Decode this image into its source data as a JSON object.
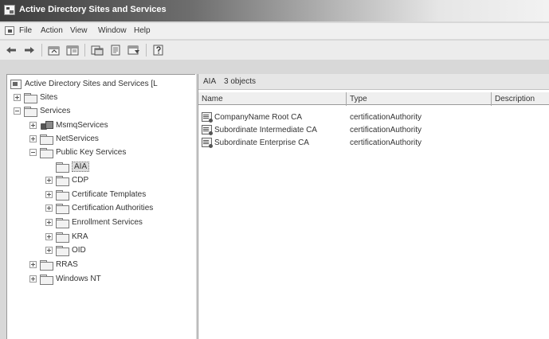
{
  "window": {
    "title": "Active Directory Sites and Services"
  },
  "menu": {
    "items": [
      "File",
      "Action",
      "View",
      "Window",
      "Help"
    ]
  },
  "toolbar": {
    "buttons": [
      "back-arrow-icon",
      "forward-arrow-icon",
      "up-level-icon",
      "show-hide-tree-icon",
      "properties-icon",
      "export-list-icon",
      "refresh-icon",
      "help-icon"
    ]
  },
  "tree": {
    "root": "Active Directory Sites and Services [L",
    "nodes": [
      {
        "label": "Sites",
        "expander": "plus"
      },
      {
        "label": "Services",
        "expander": "minus"
      },
      {
        "label": "MsmqServices",
        "expander": "plus"
      },
      {
        "label": "NetServices",
        "expander": "plus"
      },
      {
        "label": "Public Key Services",
        "expander": "minus"
      },
      {
        "label": "AIA",
        "expander": "none",
        "selected": true
      },
      {
        "label": "CDP",
        "expander": "plus"
      },
      {
        "label": "Certificate Templates",
        "expander": "plus"
      },
      {
        "label": "Certification Authorities",
        "expander": "plus"
      },
      {
        "label": "Enrollment Services",
        "expander": "plus"
      },
      {
        "label": "KRA",
        "expander": "plus"
      },
      {
        "label": "OID",
        "expander": "plus"
      },
      {
        "label": "RRAS",
        "expander": "plus"
      },
      {
        "label": "Windows NT",
        "expander": "plus"
      }
    ]
  },
  "content": {
    "path": "AIA",
    "count": "3 objects",
    "columns": [
      "Name",
      "Type",
      "Description"
    ],
    "rows": [
      {
        "name": "CompanyName Root CA",
        "type": "certificationAuthority"
      },
      {
        "name": "Subordinate Intermediate CA",
        "type": "certificationAuthority"
      },
      {
        "name": "Subordinate Enterprise CA",
        "type": "certificationAuthority"
      }
    ]
  }
}
